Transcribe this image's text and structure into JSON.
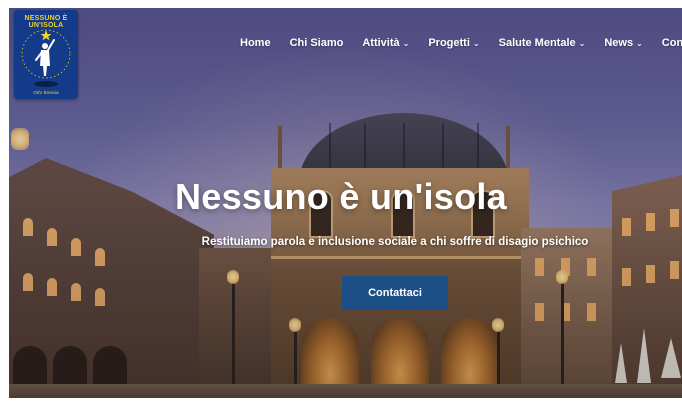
{
  "logo": {
    "title": "NESSUNO È UN'ISOLA",
    "sub": "OdV Brescia"
  },
  "nav": {
    "items": [
      {
        "label": "Home",
        "dropdown": false
      },
      {
        "label": "Chi Siamo",
        "dropdown": false
      },
      {
        "label": "Attività",
        "dropdown": true
      },
      {
        "label": "Progetti",
        "dropdown": true
      },
      {
        "label": "Salute Mentale",
        "dropdown": true
      },
      {
        "label": "News",
        "dropdown": true
      },
      {
        "label": "Contatti",
        "dropdown": false
      }
    ],
    "chevron_icon": "chevron-down-icon"
  },
  "hero": {
    "title": "Nessuno è un'isola",
    "subtitle": "Restituiamo parola e inclusione sociale a chi soffre di disagio psichico",
    "cta_label": "Contattaci"
  },
  "colors": {
    "cta_bg": "#1c4f86",
    "logo_bg": "#143a8a",
    "logo_accent": "#f1d32a"
  }
}
